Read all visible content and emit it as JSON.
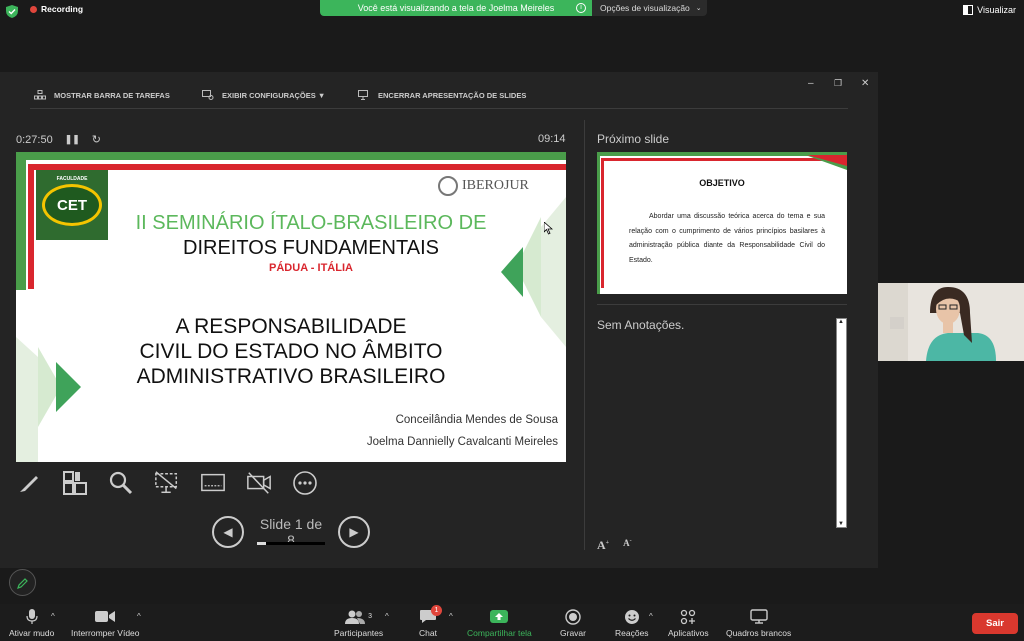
{
  "topbar": {
    "recording_label": "Recording",
    "share_banner": "Você está visualizando a tela de Joelma Meireles",
    "view_options": "Opções de visualização",
    "view_button": "Visualizar"
  },
  "presenter": {
    "toolbar": {
      "show_taskbar": "MOSTRAR BARRA DE TAREFAS",
      "display_settings": "EXIBIR CONFIGURAÇÕES ▼",
      "end_slideshow": "ENCERRAR APRESENTAÇÃO DE SLIDES"
    },
    "timer": "0:27:50",
    "clock": "09:14",
    "current_slide": {
      "logo_text": "CET",
      "logo_caption": "FACULDADE",
      "partner_logo": "IBEROJUR",
      "title_line1": "II SEMINÁRIO ÍTALO-BRASILEIRO DE",
      "title_line2": "DIREITOS FUNDAMENTAIS",
      "subtitle": "PÁDUA - ITÁLIA",
      "main_line1": "A RESPONSABILIDADE",
      "main_line2": "CIVIL DO ESTADO NO ÂMBITO",
      "main_line3": "ADMINISTRATIVO BRASILEIRO",
      "author1": "Conceilândia Mendes de Sousa",
      "author2": "Joelma Dannielly Cavalcanti Meireles"
    },
    "slide_counter": "Slide 1 de 8",
    "slide_progress": 0.125,
    "next_slide_label": "Próximo slide",
    "next_slide": {
      "title": "OBJETIVO",
      "text": "Abordar uma discussão teórica acerca do tema e sua relação com o cumprimento de vários princípios basilares à administração pública diante da Responsabilidade Civil do Estado."
    },
    "notes": "Sem Anotações."
  },
  "bottombar": {
    "mute": "Ativar mudo",
    "video": "Interromper Vídeo",
    "participants": "Participantes",
    "participants_count": "3",
    "chat": "Chat",
    "chat_badge": "1",
    "share": "Compartilhar tela",
    "record": "Gravar",
    "reactions": "Reações",
    "apps": "Aplicativos",
    "whiteboards": "Quadros brancos",
    "leave": "Sair"
  },
  "colors": {
    "share_green": "#3cb55b",
    "leave_red": "#d9382e",
    "slide_green": "#4a9d4a",
    "slide_red": "#d9262e"
  }
}
